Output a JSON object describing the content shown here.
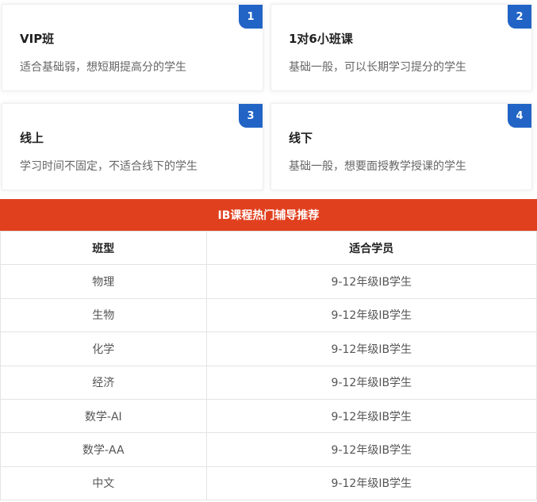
{
  "cards": [
    {
      "badge": "1",
      "title": "VIP班",
      "desc": "适合基础弱，想短期提高分的学生"
    },
    {
      "badge": "2",
      "title": "1对6小班课",
      "desc": "基础一般，可以长期学习提分的学生"
    },
    {
      "badge": "3",
      "title": "线上",
      "desc": "学习时间不固定，不适合线下的学生"
    },
    {
      "badge": "4",
      "title": "线下",
      "desc": "基础一般，想要面授教学授课的学生"
    }
  ],
  "banner": {
    "title": "IB课程热门辅导推荐"
  },
  "table": {
    "headers": [
      "班型",
      "适合学员"
    ],
    "rows": [
      [
        "物理",
        "9-12年级IB学生"
      ],
      [
        "生物",
        "9-12年级IB学生"
      ],
      [
        "化学",
        "9-12年级IB学生"
      ],
      [
        "经济",
        "9-12年级IB学生"
      ],
      [
        "数学-AI",
        "9-12年级IB学生"
      ],
      [
        "数学-AA",
        "9-12年级IB学生"
      ],
      [
        "中文",
        "9-12年级IB学生"
      ]
    ]
  },
  "colors": {
    "badge": "#2164c6",
    "banner": "#e1401f"
  }
}
